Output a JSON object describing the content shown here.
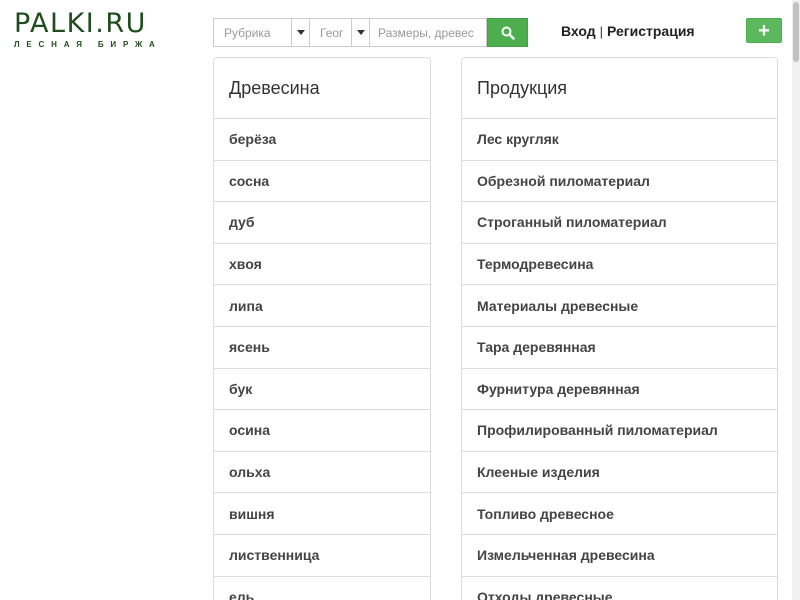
{
  "logo": {
    "main": "PALKI.RU",
    "sub": "ЛЕСНАЯ БИРЖА"
  },
  "search": {
    "rubric_placeholder": "Рубрика",
    "geo_placeholder": "Геог",
    "query_placeholder": "Размеры, древес",
    "button_icon": "search-icon"
  },
  "auth": {
    "login": "Вход",
    "separator": "|",
    "register": "Регистрация"
  },
  "add_button": {
    "icon": "plus-icon",
    "label": "+"
  },
  "wood": {
    "title": "Древесина",
    "items": [
      "берёза",
      "сосна",
      "дуб",
      "хвоя",
      "липа",
      "ясень",
      "бук",
      "осина",
      "ольха",
      "вишня",
      "лиственница",
      "ель"
    ]
  },
  "products": {
    "title": "Продукция",
    "items": [
      "Лес кругляк",
      "Обрезной пиломатериал",
      "Строганный пиломатериал",
      "Термодревесина",
      "Материалы древесные",
      "Тара деревянная",
      "Фурнитура деревянная",
      "Профилированный пиломатериал",
      "Клееные изделия",
      "Топливо древесное",
      "Измельченная древесина",
      "Отходы древесные"
    ]
  },
  "colors": {
    "brand": "#1f4d1f",
    "accent": "#5cb85c"
  }
}
